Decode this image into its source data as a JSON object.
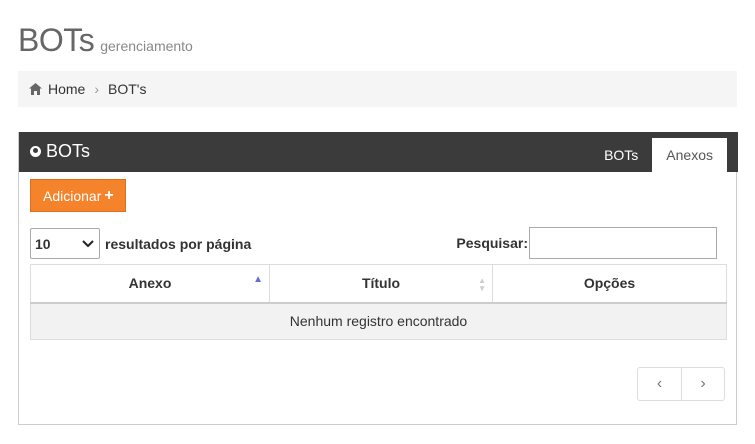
{
  "header": {
    "title": "BOTs",
    "subtitle": "gerenciamento"
  },
  "breadcrumb": {
    "items": [
      "Home",
      "BOT's"
    ]
  },
  "panel": {
    "title": "BOTs",
    "tabs": [
      {
        "label": "BOTs",
        "active": false
      },
      {
        "label": "Anexos",
        "active": true
      }
    ],
    "add_button": "Adicionar"
  },
  "table_controls": {
    "length_value": "10",
    "length_label": "resultados por página",
    "search_label": "Pesquisar:",
    "search_value": ""
  },
  "table": {
    "columns": [
      "Anexo",
      "Título",
      "Opções"
    ],
    "empty_message": "Nenhum registro encontrado"
  },
  "pagination": {
    "prev": "‹",
    "next": "›"
  },
  "colors": {
    "header_bg": "#3b3b3b",
    "add_button_bg": "#f5832b",
    "breadcrumb_bg": "#f5f5f5",
    "sort_active": "#6b6bd6"
  }
}
